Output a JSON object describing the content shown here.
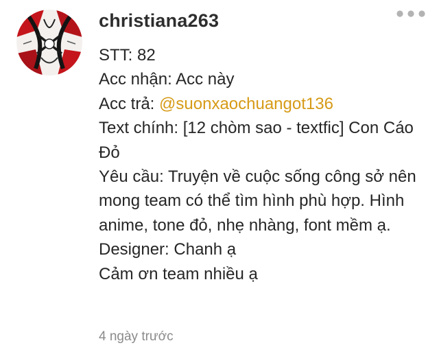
{
  "comment": {
    "username": "christiana263",
    "avatar_icon": "user-avatar-red-black-art",
    "more_icon": "more-dots-icon",
    "lines": {
      "stt": "STT: 82",
      "acc_receive": "Acc nhận: Acc này",
      "acc_pay_label": "Acc trả: ",
      "acc_pay_mention": "@suonxaochuangot136",
      "main_text": "Text chính: [12 chòm sao - textfic] Con Cáo Đỏ",
      "request": "Yêu cầu: Truyện về cuộc sống công sở nên mong team có thể tìm hình phù hợp. Hình anime, tone đỏ, nhẹ nhàng, font mềm ạ.",
      "designer": "Designer: Chanh ạ",
      "thanks": "Cảm ơn team nhiều ạ"
    },
    "timestamp": "4 ngày trước"
  },
  "colors": {
    "mention": "#d69a16",
    "timestamp": "#8a8a8a",
    "dots": "#b3b3b3"
  }
}
